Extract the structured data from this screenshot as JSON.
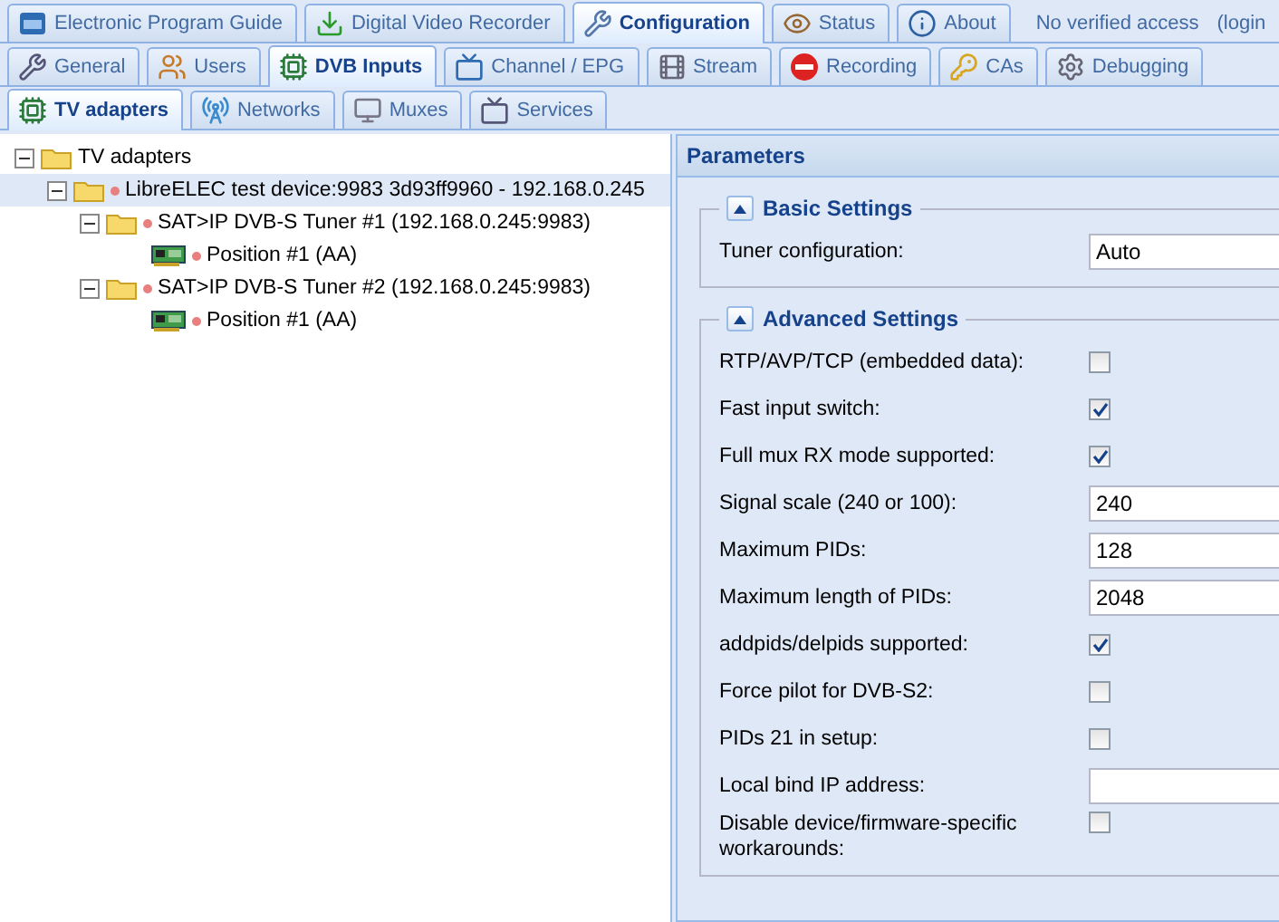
{
  "main_tabs": [
    {
      "label": "Electronic Program Guide",
      "selected": false
    },
    {
      "label": "Digital Video Recorder",
      "selected": false
    },
    {
      "label": "Configuration",
      "selected": true
    },
    {
      "label": "Status",
      "selected": false
    },
    {
      "label": "About",
      "selected": false
    }
  ],
  "access_status": "No verified access",
  "login_link": "(login",
  "config_tabs": [
    {
      "label": "General",
      "selected": false
    },
    {
      "label": "Users",
      "selected": false
    },
    {
      "label": "DVB Inputs",
      "selected": true
    },
    {
      "label": "Channel / EPG",
      "selected": false
    },
    {
      "label": "Stream",
      "selected": false
    },
    {
      "label": "Recording",
      "selected": false
    },
    {
      "label": "CAs",
      "selected": false
    },
    {
      "label": "Debugging",
      "selected": false
    }
  ],
  "dvb_tabs": [
    {
      "label": "TV adapters",
      "selected": true
    },
    {
      "label": "Networks",
      "selected": false
    },
    {
      "label": "Muxes",
      "selected": false
    },
    {
      "label": "Services",
      "selected": false
    }
  ],
  "tree": [
    {
      "label": "TV adapters",
      "kind": "root",
      "expanded": true,
      "selected": false,
      "children": [
        {
          "label": "LibreELEC test device:9983 3d93ff9960 - 192.168.0.245",
          "kind": "device",
          "expanded": true,
          "selected": true,
          "children": [
            {
              "label": "SAT>IP DVB-S Tuner #1 (192.168.0.245:9983)",
              "kind": "tuner",
              "expanded": true,
              "selected": false,
              "children": [
                {
                  "label": "Position #1 (AA)",
                  "kind": "position",
                  "selected": false
                }
              ]
            },
            {
              "label": "SAT>IP DVB-S Tuner #2 (192.168.0.245:9983)",
              "kind": "tuner",
              "expanded": true,
              "selected": false,
              "children": [
                {
                  "label": "Position #1 (AA)",
                  "kind": "position",
                  "selected": false
                }
              ]
            }
          ]
        }
      ]
    }
  ],
  "parameters": {
    "title": "Parameters",
    "sections": [
      {
        "title": "Basic Settings",
        "expanded": true,
        "fields": [
          {
            "kind": "text",
            "label": "Tuner configuration:",
            "value": "Auto"
          }
        ]
      },
      {
        "title": "Advanced Settings",
        "expanded": true,
        "fields": [
          {
            "kind": "checkbox",
            "label": "RTP/AVP/TCP (embedded data):",
            "checked": false
          },
          {
            "kind": "checkbox",
            "label": "Fast input switch:",
            "checked": true
          },
          {
            "kind": "checkbox",
            "label": "Full mux RX mode supported:",
            "checked": true
          },
          {
            "kind": "text",
            "label": "Signal scale (240 or 100):",
            "value": "240"
          },
          {
            "kind": "text",
            "label": "Maximum PIDs:",
            "value": "128"
          },
          {
            "kind": "text",
            "label": "Maximum length of PIDs:",
            "value": "2048"
          },
          {
            "kind": "checkbox",
            "label": "addpids/delpids supported:",
            "checked": true
          },
          {
            "kind": "checkbox",
            "label": "Force pilot for DVB-S2:",
            "checked": false
          },
          {
            "kind": "checkbox",
            "label": "PIDs 21 in setup:",
            "checked": false
          },
          {
            "kind": "text",
            "label": "Local bind IP address:"
          },
          {
            "kind": "checkbox",
            "label": "Disable device/firmware-specific workarounds:",
            "checked": false
          }
        ]
      }
    ]
  }
}
